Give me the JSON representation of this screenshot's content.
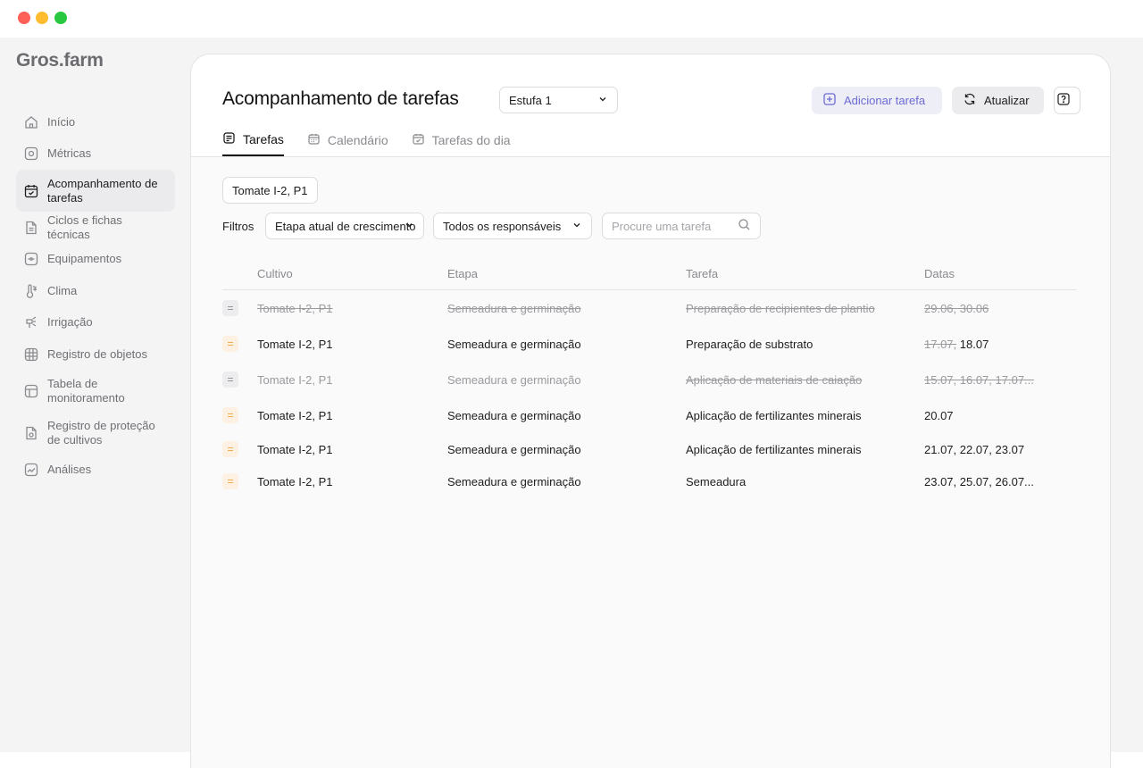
{
  "app": {
    "logo": "Gros.farm"
  },
  "sidebar": {
    "items": [
      {
        "label": "Início",
        "icon": "home-icon"
      },
      {
        "label": "Métricas",
        "icon": "metrics-icon"
      },
      {
        "label": "Acompanhamento de tarefas",
        "icon": "calendar-check-icon",
        "active": true
      },
      {
        "label": "Ciclos e fichas técnicas",
        "icon": "document-icon"
      },
      {
        "label": "Equipamentos",
        "icon": "device-icon"
      },
      {
        "label": "Clima",
        "icon": "thermometer-icon"
      },
      {
        "label": "Irrigação",
        "icon": "sprinkler-icon"
      },
      {
        "label": "Registro de objetos",
        "icon": "grid-icon"
      },
      {
        "label": "Tabela de monitoramento",
        "icon": "table-icon"
      },
      {
        "label": "Registro de proteção de cultivos",
        "icon": "protection-doc-icon"
      },
      {
        "label": "Análises",
        "icon": "chart-icon"
      }
    ]
  },
  "header": {
    "title": "Acompanhamento de tarefas",
    "greenhouse": "Estufa 1",
    "add_task_label": "Adicionar tarefa",
    "refresh_label": "Atualizar",
    "help_label": "?"
  },
  "tabs": [
    {
      "label": "Tarefas",
      "active": true,
      "icon": "tasks-icon"
    },
    {
      "label": "Calendário",
      "active": false,
      "icon": "calendar-icon"
    },
    {
      "label": "Tarefas do dia",
      "active": false,
      "icon": "calendar-today-icon"
    }
  ],
  "chip": "Tomate I-2, P1",
  "filters": {
    "label": "Filtros",
    "stage": "Etapa atual de crescimento",
    "responsible": "Todos os responsáveis",
    "search_placeholder": "Procure uma tarefa"
  },
  "table": {
    "headers": {
      "crop": "Cultivo",
      "stage": "Etapa",
      "task": "Tarefa",
      "dates": "Datas"
    },
    "rows": [
      {
        "crop": "Tomate I-2, P1",
        "stage": "Semeadura e germinação",
        "task": "Preparação de recipientes de plantio",
        "dates_done": "29.06, 30.06",
        "dates": "",
        "done": true,
        "priority": "gray"
      },
      {
        "crop": "Tomate I-2, P1",
        "stage": "Semeadura e germinação",
        "task": "Preparação de substrato",
        "dates_done": "17.07,",
        "dates": " 18.07",
        "done": false,
        "priority": "orange"
      },
      {
        "crop": "Tomate I-2, P1",
        "stage": "Semeadura e germinação",
        "task": "Aplicação de materiais de caiação",
        "dates_done": "15.07, 16.07, 17.07...",
        "dates": "",
        "done": true,
        "priority": "gray"
      },
      {
        "crop": "Tomate I-2, P1",
        "stage": "Semeadura e germinação",
        "task": "Aplicação de fertilizantes minerais",
        "dates_done": "",
        "dates": "20.07",
        "done": false,
        "priority": "orange"
      },
      {
        "crop": "Tomate I-2, P1",
        "stage": "Semeadura e germinação",
        "task": "Aplicação de fertilizantes minerais",
        "dates_done": "",
        "dates": "21.07, 22.07, 23.07",
        "done": false,
        "priority": "orange"
      },
      {
        "crop": "Tomate I-2, P1",
        "stage": "Semeadura e germinação",
        "task": "Semeadura",
        "dates_done": "",
        "dates": "23.07, 25.07, 26.07...",
        "done": false,
        "priority": "orange"
      }
    ]
  },
  "colors": {
    "accent": "#6d6ad6",
    "priority_orange": "#f0a13c",
    "muted": "#9a9a9f"
  }
}
